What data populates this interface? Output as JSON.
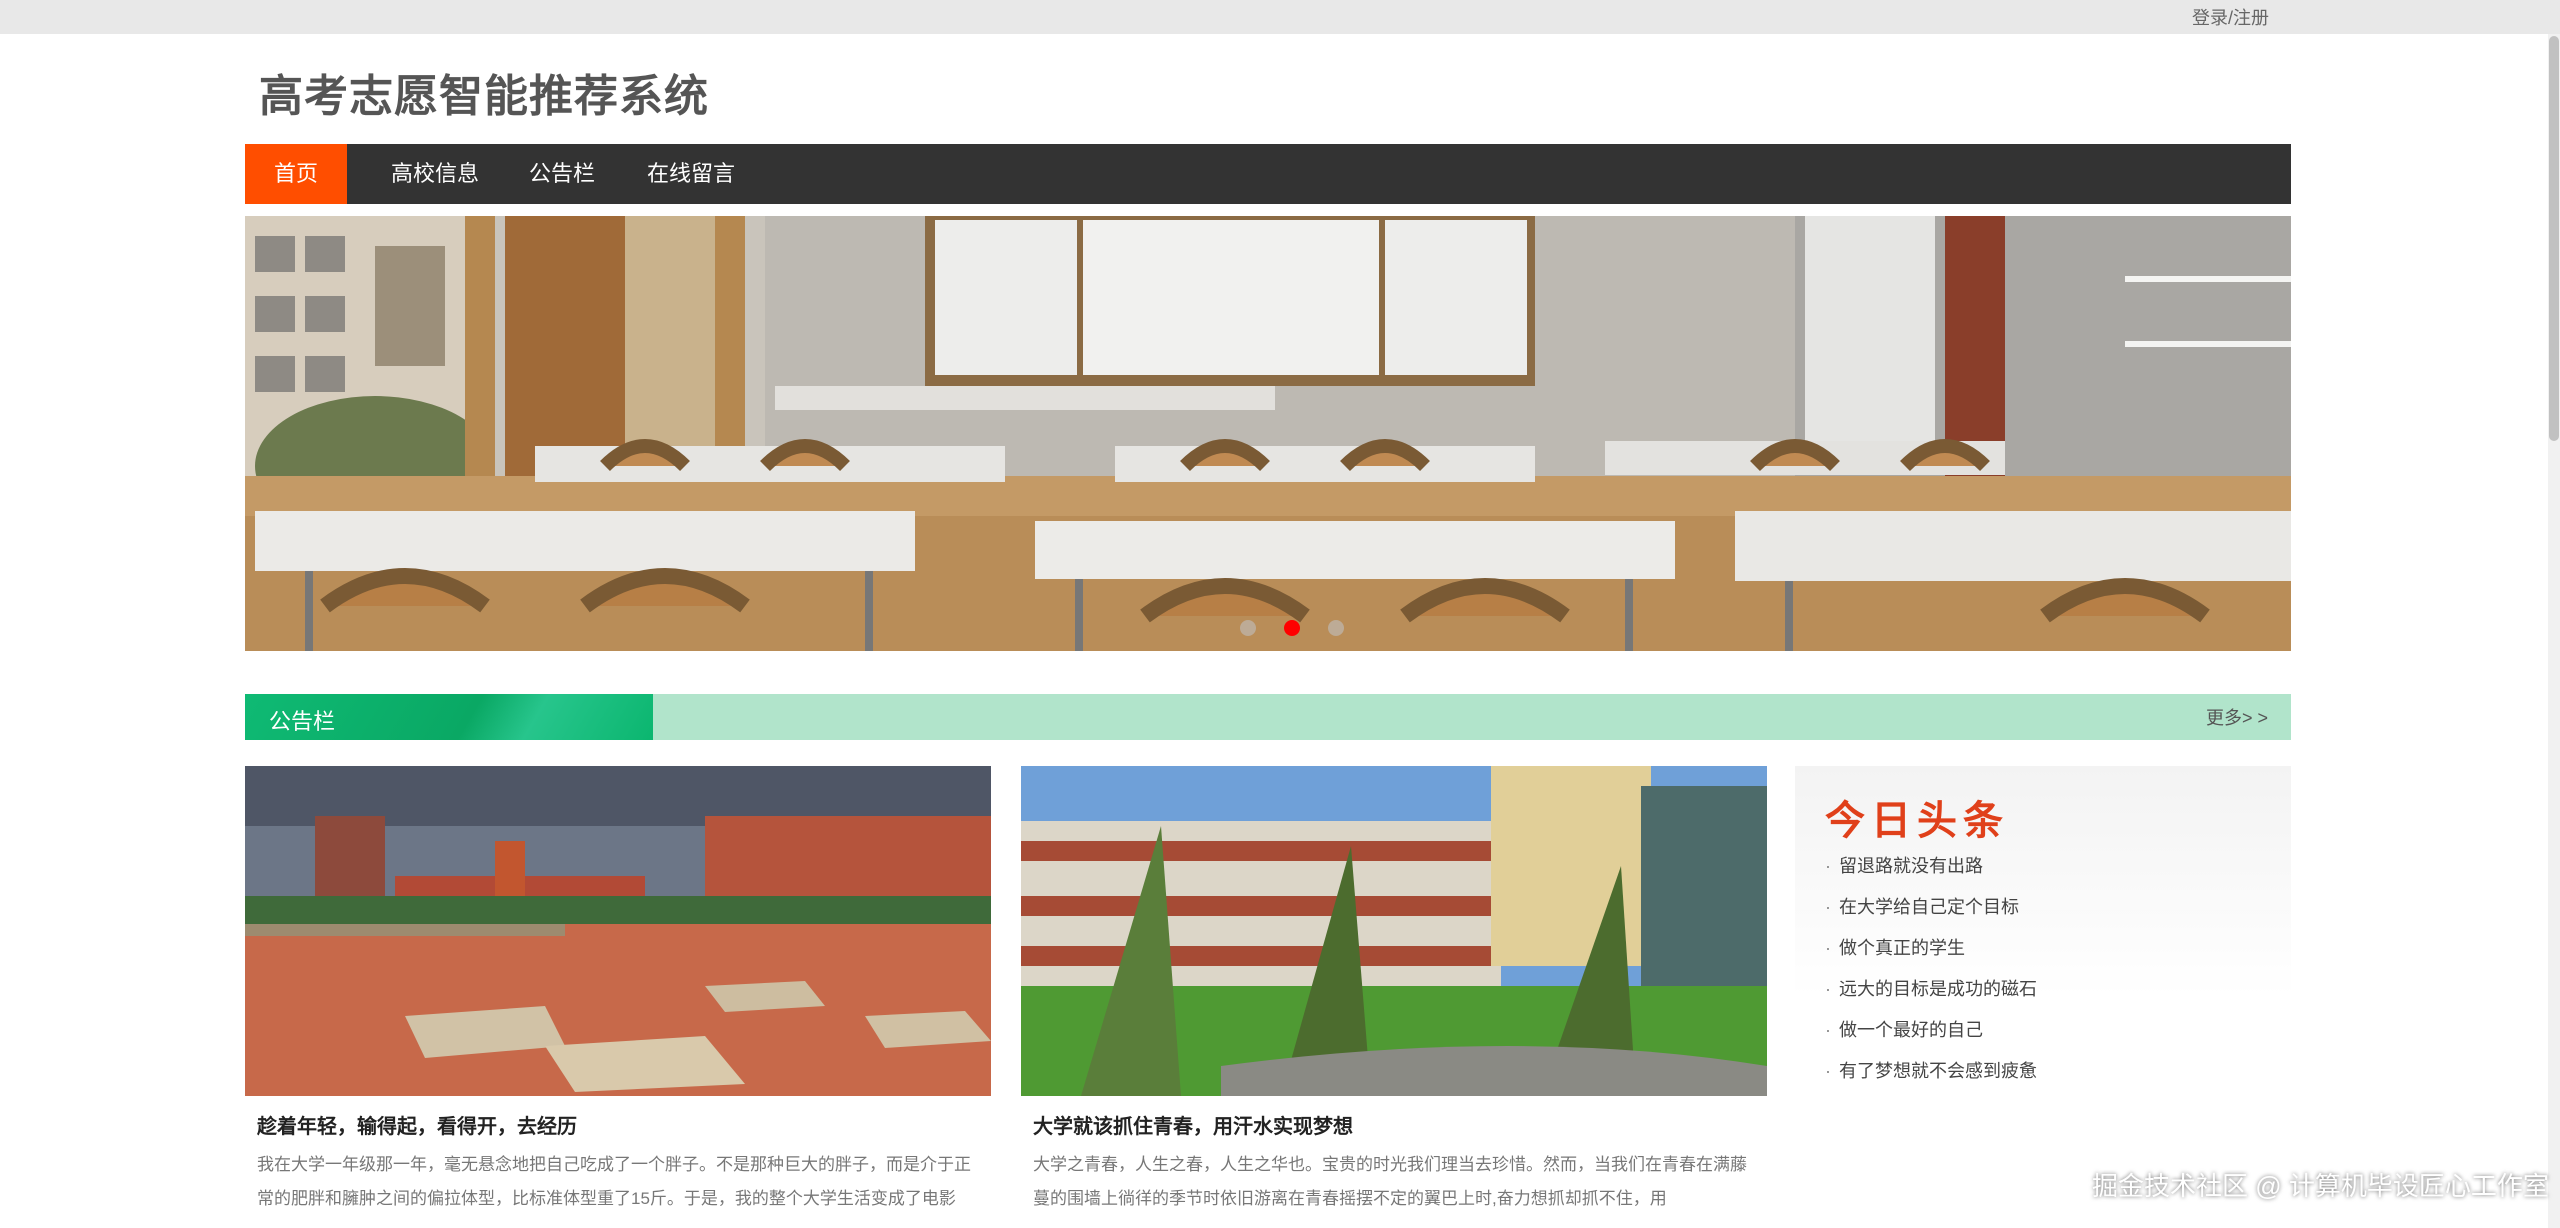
{
  "topbar": {
    "login_label": "登录/注册"
  },
  "site": {
    "title": "高考志愿智能推荐系统"
  },
  "nav": {
    "items": [
      {
        "label": "首页",
        "active": true
      },
      {
        "label": "高校信息",
        "active": false
      },
      {
        "label": "公告栏",
        "active": false
      },
      {
        "label": "在线留言",
        "active": false
      }
    ]
  },
  "banner": {
    "slide_count": 3,
    "active_slide": 2
  },
  "notice": {
    "title": "公告栏",
    "more_label": "更多> >"
  },
  "cards": [
    {
      "title": "趁着年轻，输得起，看得开，去经历",
      "text": "我在大学一年级那一年，毫无悬念地把自己吃成了一个胖子。不是那种巨大的胖子，而是介于正常的肥胖和臃肿之间的偏拉体型，比标准体型重了15斤。于是，我的整个大学生活变成了电影"
    },
    {
      "title": "大学就该抓住青春，用汗水实现梦想",
      "text": "大学之青春，人生之春，人生之华也。宝贵的时光我们理当去珍惜。然而，当我们在青春在满藤蔓的围墙上徜徉的季节时依旧游离在青春摇摆不定的翼巴上时,奋力想抓却抓不住，用"
    }
  ],
  "headlines": {
    "title": "今日头条",
    "items": [
      "留退路就没有出路",
      "在大学给自己定个目标",
      "做个真正的学生",
      "远大的目标是成功的磁石",
      "做一个最好的自己",
      "有了梦想就不会感到疲惫"
    ]
  },
  "watermark": "掘金技术社区 @ 计算机毕设匠心工作室",
  "colors": {
    "nav_bg": "#333333",
    "nav_active": "#ff4e00",
    "notice_green": "#0fba74",
    "notice_bar": "#b1e4cb",
    "headline_red": "#e0401a",
    "dot_active": "#ff0000"
  }
}
